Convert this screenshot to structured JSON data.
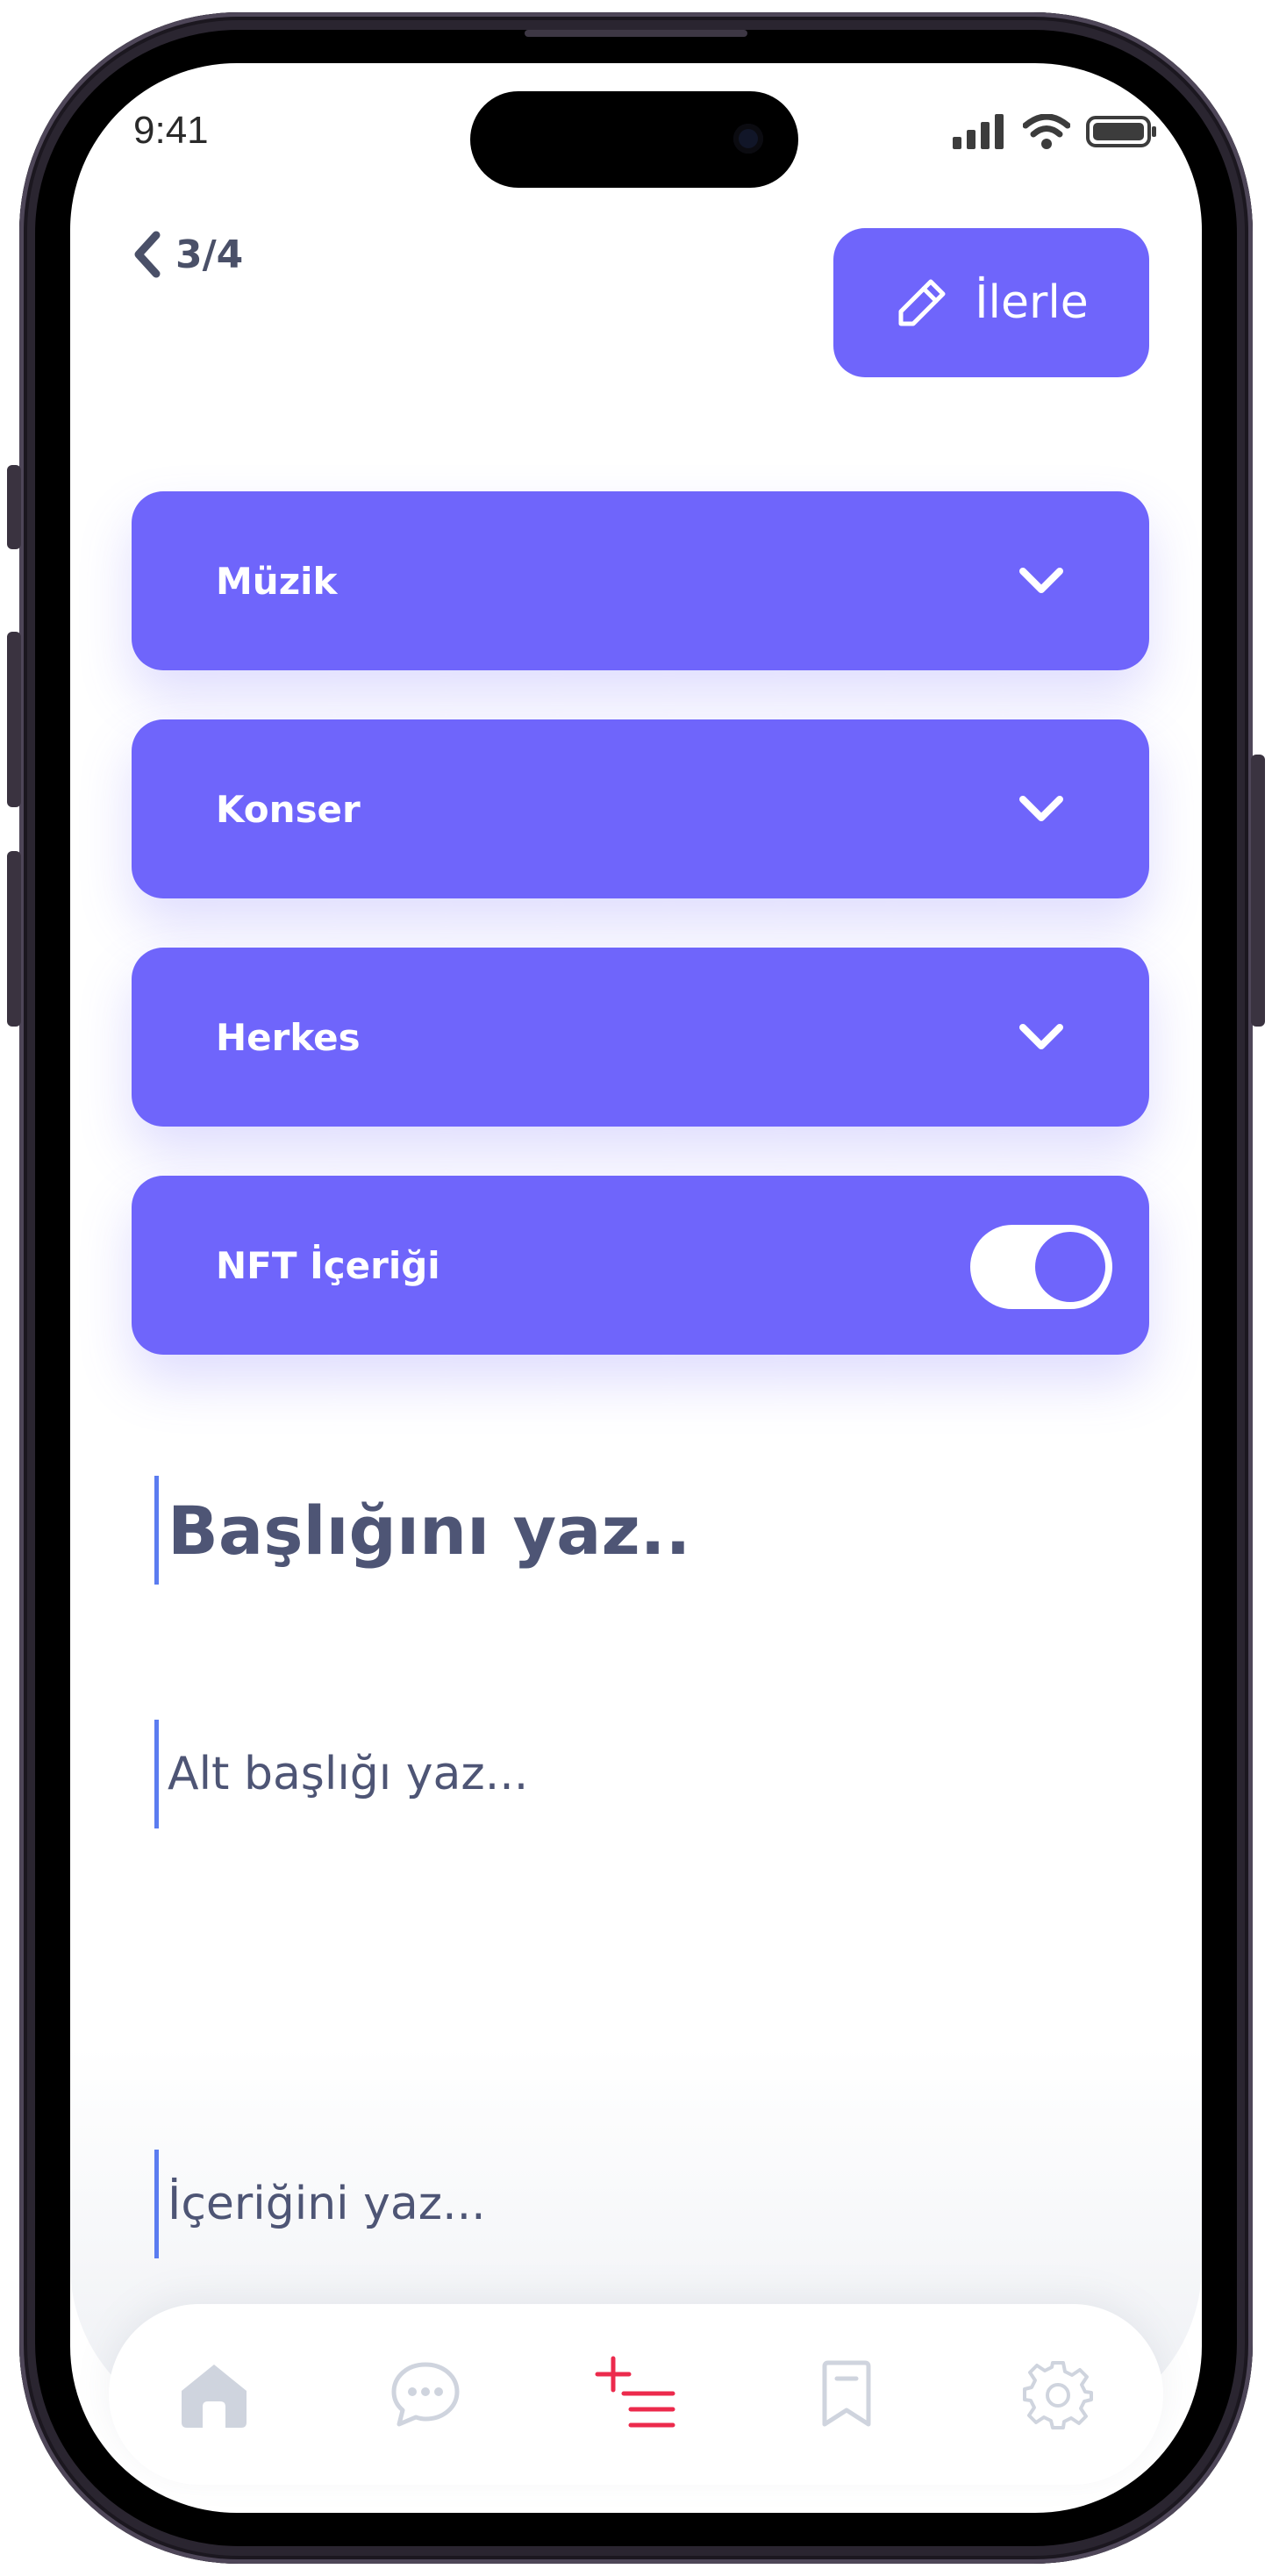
{
  "status_bar": {
    "time": "9:41"
  },
  "header": {
    "step": "3/4",
    "next_label": "İlerle"
  },
  "selects": [
    {
      "label": "Müzik"
    },
    {
      "label": "Konser"
    },
    {
      "label": "Herkes"
    }
  ],
  "nft_toggle": {
    "label": "NFT İçeriği",
    "on": true
  },
  "fields": {
    "title_placeholder": "Başlığını yaz..",
    "subtitle_placeholder": "Alt başlığı yaz...",
    "content_placeholder": "İçeriğini yaz..."
  },
  "nav": {
    "items": [
      "home-icon",
      "chat-icon",
      "create-post-icon",
      "bookmark-icon",
      "settings-icon"
    ],
    "active": "create-post-icon"
  },
  "colors": {
    "accent": "#6f65fb",
    "text": "#4e5575",
    "nav_active": "#ec2a4c",
    "nav_inactive": "#cfd4de"
  }
}
